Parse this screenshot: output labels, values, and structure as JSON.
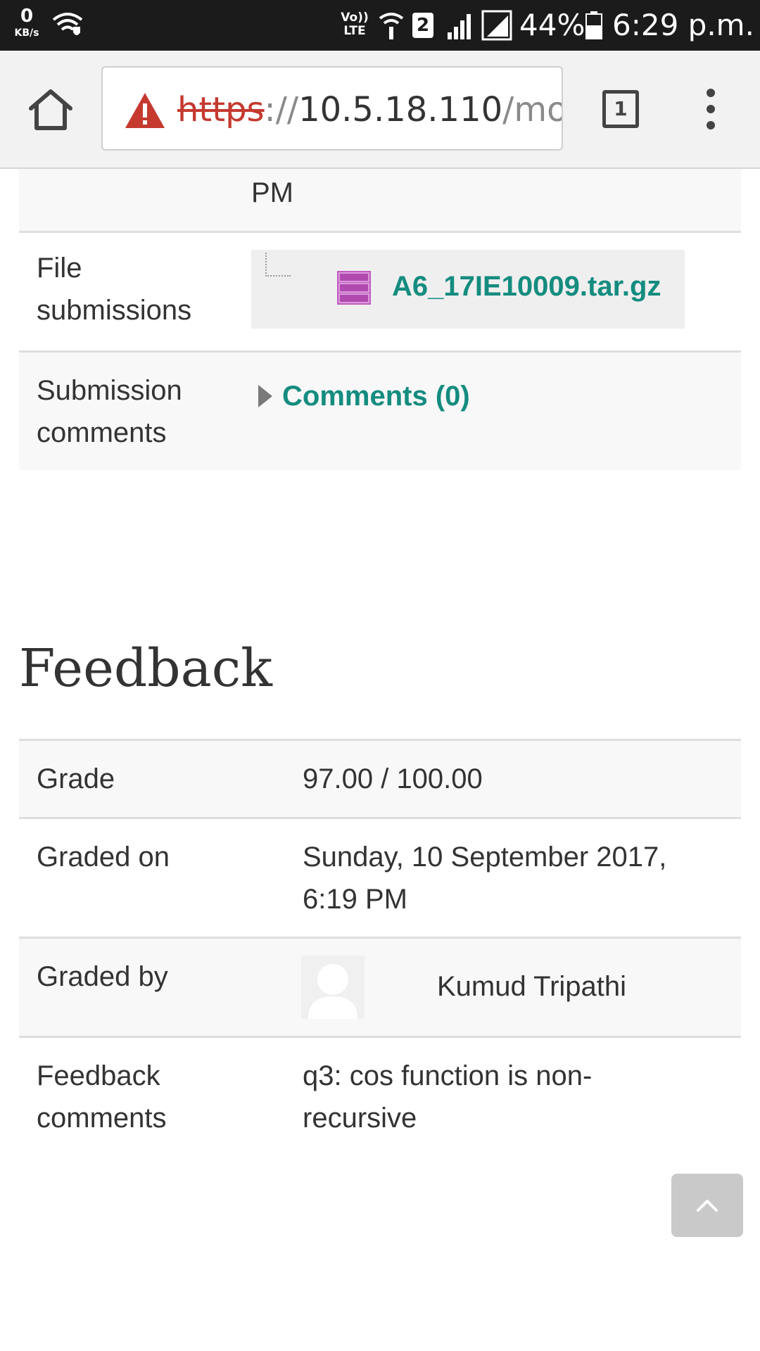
{
  "status_bar": {
    "speed_value": "0",
    "speed_unit": "KB/s",
    "volte_label": "Vo)) LTE",
    "sim_slot": "2",
    "battery": "44%",
    "time": "6:29 p.m."
  },
  "browser": {
    "url_scheme": "https",
    "url_sep": "://",
    "url_host": "10.5.18.110",
    "url_path": "/moodle/mod/assign/view.php",
    "tab_count": "1"
  },
  "submission": {
    "top_row_value": "PM",
    "file_label_1": "File",
    "file_label_2": "submissions",
    "file_name": "A6_17IE10009.tar.gz",
    "comments_label_1": "Submission",
    "comments_label_2": "comments",
    "comments_link": "Comments (0)"
  },
  "feedback": {
    "heading": "Feedback",
    "grade_label": "Grade",
    "grade_value": "97.00 / 100.00",
    "graded_on_label": "Graded on",
    "graded_on_line1": "Sunday, 10 September 2017,",
    "graded_on_line2": "6:19 PM",
    "graded_by_label": "Graded by",
    "grader_name": "Kumud Tripathi",
    "comments_label_1": "Feedback",
    "comments_label_2": "comments",
    "comments_line1": "q3: cos function is non-",
    "comments_line2": "recursive"
  },
  "colors": {
    "link": "#148c7f",
    "warning": "#c5392f",
    "status_bar": "#1b1b1b"
  },
  "icons": [
    "home-icon",
    "warning-icon",
    "tab-switcher-icon",
    "overflow-menu-icon",
    "archive-file-icon",
    "expand-triangle-icon",
    "user-avatar-icon",
    "chevron-up-icon",
    "wifi-icon",
    "signal-icon",
    "battery-icon"
  ]
}
